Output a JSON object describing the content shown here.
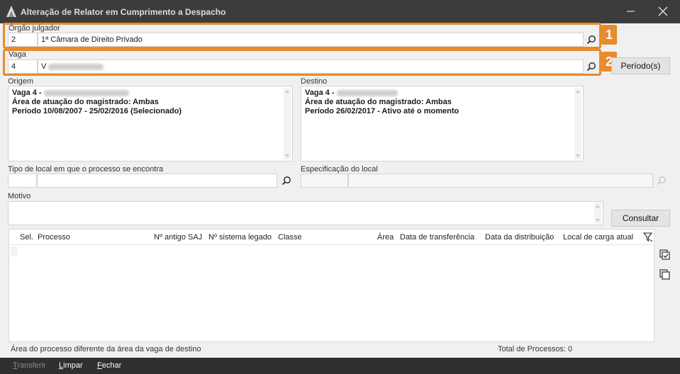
{
  "window": {
    "title": "Alteração de Relator em Cumprimento a Despacho"
  },
  "orgao": {
    "label": "Órgão julgador",
    "code": "2",
    "name": "1ª Câmara de Direito Privado"
  },
  "vaga": {
    "label": "Vaga",
    "code": "4",
    "name": "V"
  },
  "badges": {
    "b1": "1",
    "b2": "2"
  },
  "buttons": {
    "periodos": "Período(s)",
    "consultar": "Consultar"
  },
  "origem": {
    "label": "Origem",
    "lines": [
      "Vaga 4 - ",
      "Área de atuação do magistrado: Ambas",
      "Período 10/08/2007 -  25/02/2016 (Selecionado)"
    ]
  },
  "destino": {
    "label": "Destino",
    "lines": [
      "Vaga 4 - ",
      "Área de atuação do magistrado: Ambas",
      "Período 26/02/2017 - Ativo até o momento"
    ]
  },
  "tipo_local": {
    "label": "Tipo de local em que o processo se encontra",
    "code": "",
    "value": ""
  },
  "especificacao": {
    "label": "Especificação do local",
    "code": "",
    "value": ""
  },
  "motivo": {
    "label": "Motivo",
    "value": ""
  },
  "grid": {
    "columns": [
      "Sel.",
      "Processo",
      "Nº antigo SAJ",
      "Nº sistema legado",
      "Classe",
      "Área",
      "Data de transferência",
      "Data da distribuição",
      "Local de carga atual"
    ],
    "rows": []
  },
  "status": {
    "left": "Área do processo diferente da área da vaga de destino",
    "right": "Total de Processos: 0"
  },
  "footer": {
    "transferir": {
      "first": "T",
      "rest": "ransferir"
    },
    "limpar": {
      "first": "L",
      "rest": "impar"
    },
    "fechar": {
      "first": "F",
      "rest": "echar"
    }
  },
  "icons": {
    "app": "app-logo-icon",
    "minimize": "minimize-icon",
    "close": "close-icon",
    "search": "search-icon",
    "filter": "filter-icon",
    "select_all": "select-all-icon",
    "copy": "copy-icon"
  },
  "colors": {
    "titlebar": "#3c3c3c",
    "footer": "#2f2f2f",
    "highlight": "#e88a2e"
  }
}
